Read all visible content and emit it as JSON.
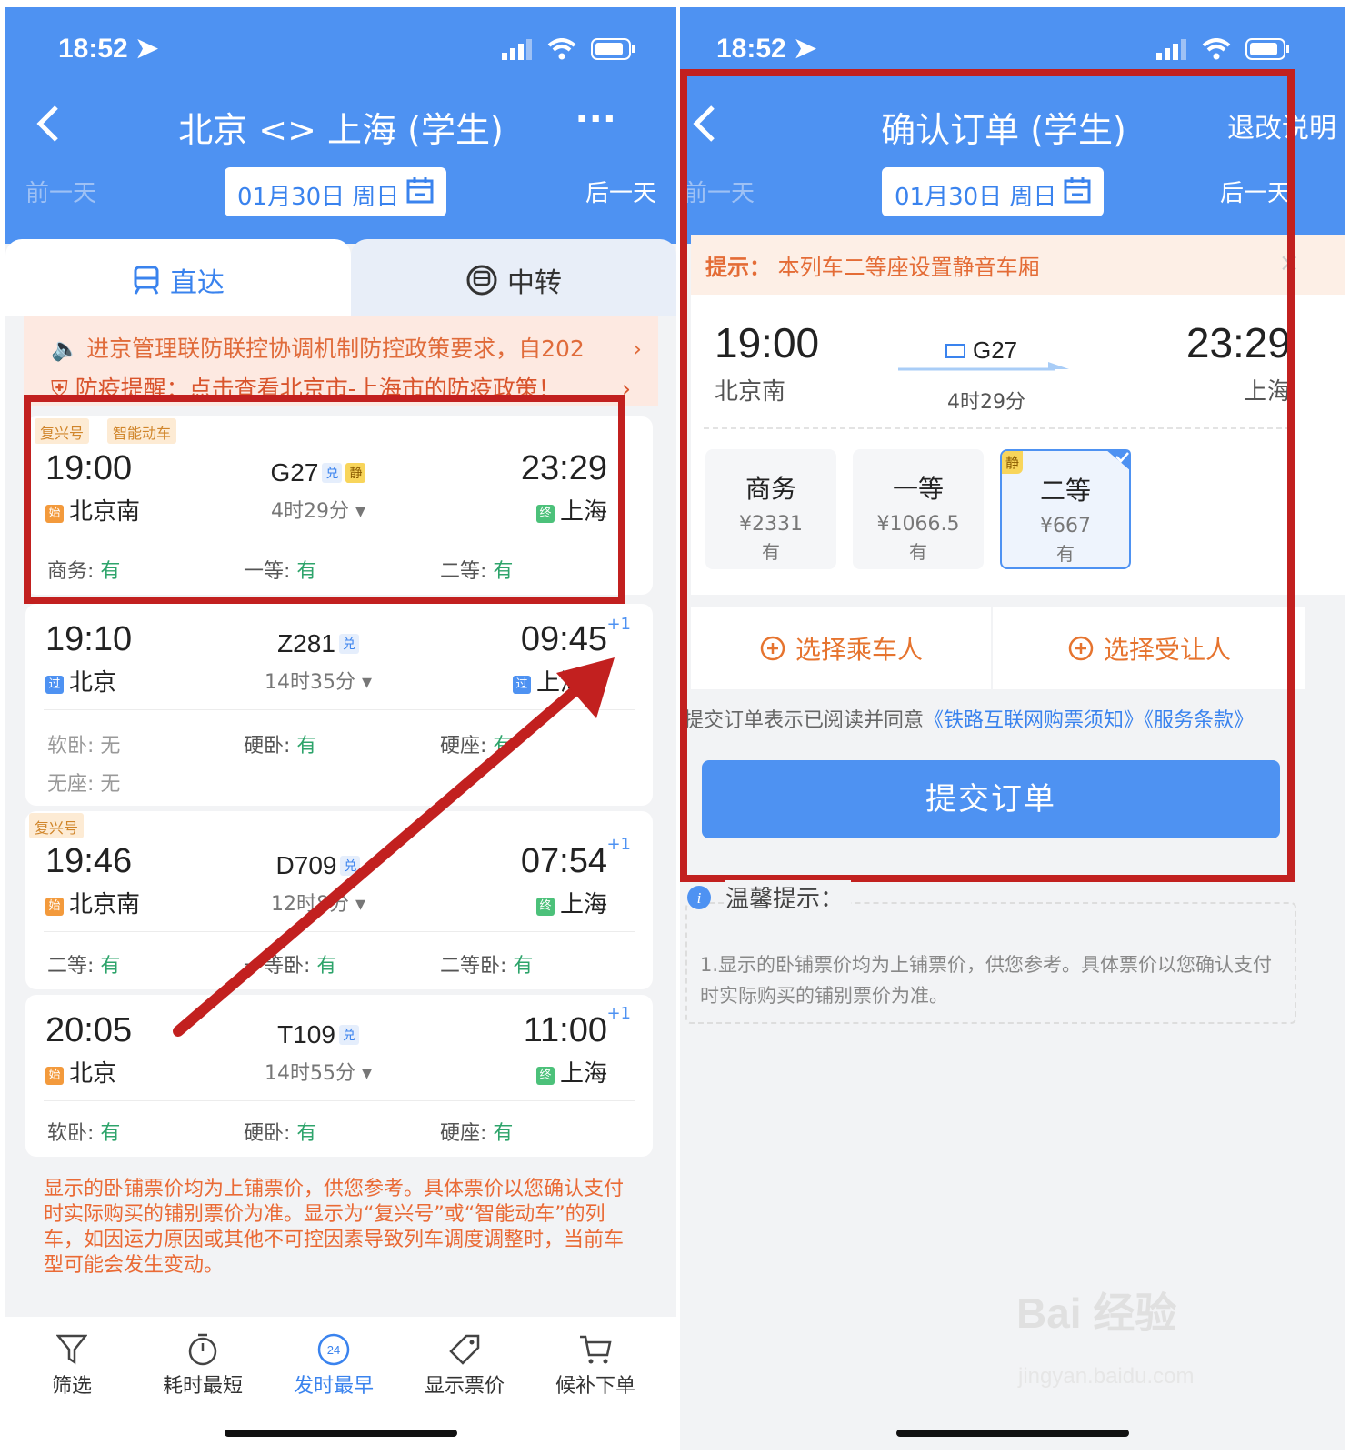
{
  "left": {
    "status_time": "18:52",
    "title": "北京 <> 上海 (学生)",
    "more": "···",
    "prev_day": "前一天",
    "next_day": "后一天",
    "date": "01月30日 周日",
    "tabs": [
      "直达",
      "中转"
    ],
    "notice1": "进京管理联防联控协调机制防控政策要求，自202",
    "notice2": "防疫提醒：点击查看北京市-上海市的防疫政策！",
    "trains": [
      {
        "badges": [
          "复兴号",
          "智能动车"
        ],
        "dep": "19:00",
        "arr": "23:29",
        "from_tag": "始",
        "from": "北京南",
        "to_tag": "终",
        "to": "上海",
        "no": "G27",
        "m1": "兑",
        "m2": "静",
        "dur": "4时29分",
        "plus": "",
        "seats": [
          {
            "k": "商务:",
            "v": "有"
          },
          {
            "k": "一等:",
            "v": "有"
          },
          {
            "k": "二等:",
            "v": "有"
          }
        ],
        "seats2": []
      },
      {
        "badges": [],
        "dep": "19:10",
        "arr": "09:45",
        "from_tag": "过",
        "from": "北京",
        "to_tag": "过",
        "to": "上海南",
        "no": "Z281",
        "m1": "兑",
        "m2": "",
        "dur": "14时35分",
        "plus": "+1",
        "seats": [
          {
            "k": "软卧:",
            "v": "无"
          },
          {
            "k": "硬卧:",
            "v": "有"
          },
          {
            "k": "硬座:",
            "v": "有"
          }
        ],
        "seats2": [
          {
            "k": "无座:",
            "v": "无"
          }
        ]
      },
      {
        "badges": [
          "复兴号"
        ],
        "dep": "19:46",
        "arr": "07:54",
        "from_tag": "始",
        "from": "北京南",
        "to_tag": "终",
        "to": "上海",
        "no": "D709",
        "m1": "兑",
        "m2": "",
        "dur": "12时8分",
        "plus": "+1",
        "seats": [
          {
            "k": "二等:",
            "v": "有"
          },
          {
            "k": "一等卧:",
            "v": "有"
          },
          {
            "k": "二等卧:",
            "v": "有"
          }
        ],
        "seats2": []
      },
      {
        "badges": [],
        "dep": "20:05",
        "arr": "11:00",
        "from_tag": "始",
        "from": "北京",
        "to_tag": "终",
        "to": "上海",
        "no": "T109",
        "m1": "兑",
        "m2": "",
        "dur": "14时55分",
        "plus": "+1",
        "seats": [
          {
            "k": "软卧:",
            "v": "有"
          },
          {
            "k": "硬卧:",
            "v": "有"
          },
          {
            "k": "硬座:",
            "v": "有"
          }
        ],
        "seats2": []
      }
    ],
    "footnote": "显示的卧铺票价均为上铺票价，供您参考。具体票价以您确认支付时实际购买的铺别票价为准。显示为“复兴号”或“智能动车”的列车，如因运力原因或其他不可控因素导致列车调度调整时，当前车型可能会发生变动。",
    "bottom": [
      "筛选",
      "耗时最短",
      "发时最早",
      "显示票价",
      "候补下单"
    ],
    "clock_num": "24"
  },
  "right": {
    "status_time": "18:52",
    "title": "确认订单 (学生)",
    "rules": "退改说明",
    "prev_day": "前一天",
    "next_day": "后一天",
    "date": "01月30日 周日",
    "tip_label": "提示：",
    "tip_text": "本列车二等座设置静音车厢",
    "tip_close": "×",
    "dep": "19:00",
    "from": "北京南",
    "no": "G27",
    "dur": "4时29分",
    "arr": "23:29",
    "to": "上海",
    "seats": [
      {
        "n": "商务",
        "p": "¥2331",
        "a": "有"
      },
      {
        "n": "一等",
        "p": "¥1066.5",
        "a": "有"
      },
      {
        "n": "二等",
        "p": "¥667",
        "a": "有",
        "tag": "静"
      }
    ],
    "pass1": "选择乘车人",
    "pass2": "选择受让人",
    "agree": "提交订单表示已阅读并同意",
    "agree_link": "《铁路互联网购票须知》《服务条款》",
    "submit": "提交订单",
    "warm_title": "温馨提示：",
    "warm_text": "1.显示的卧铺票价均为上铺票价，供您参考。具体票价以您确认支付时实际购买的铺别票价为准。",
    "watermark": "Bai 经验",
    "watermark_url": "jingyan.baidu.com"
  },
  "colors": {
    "blue": "#4e92f2",
    "red_annot": "#c2201f",
    "orange": "#ea6a35",
    "green": "#2ea46b"
  }
}
